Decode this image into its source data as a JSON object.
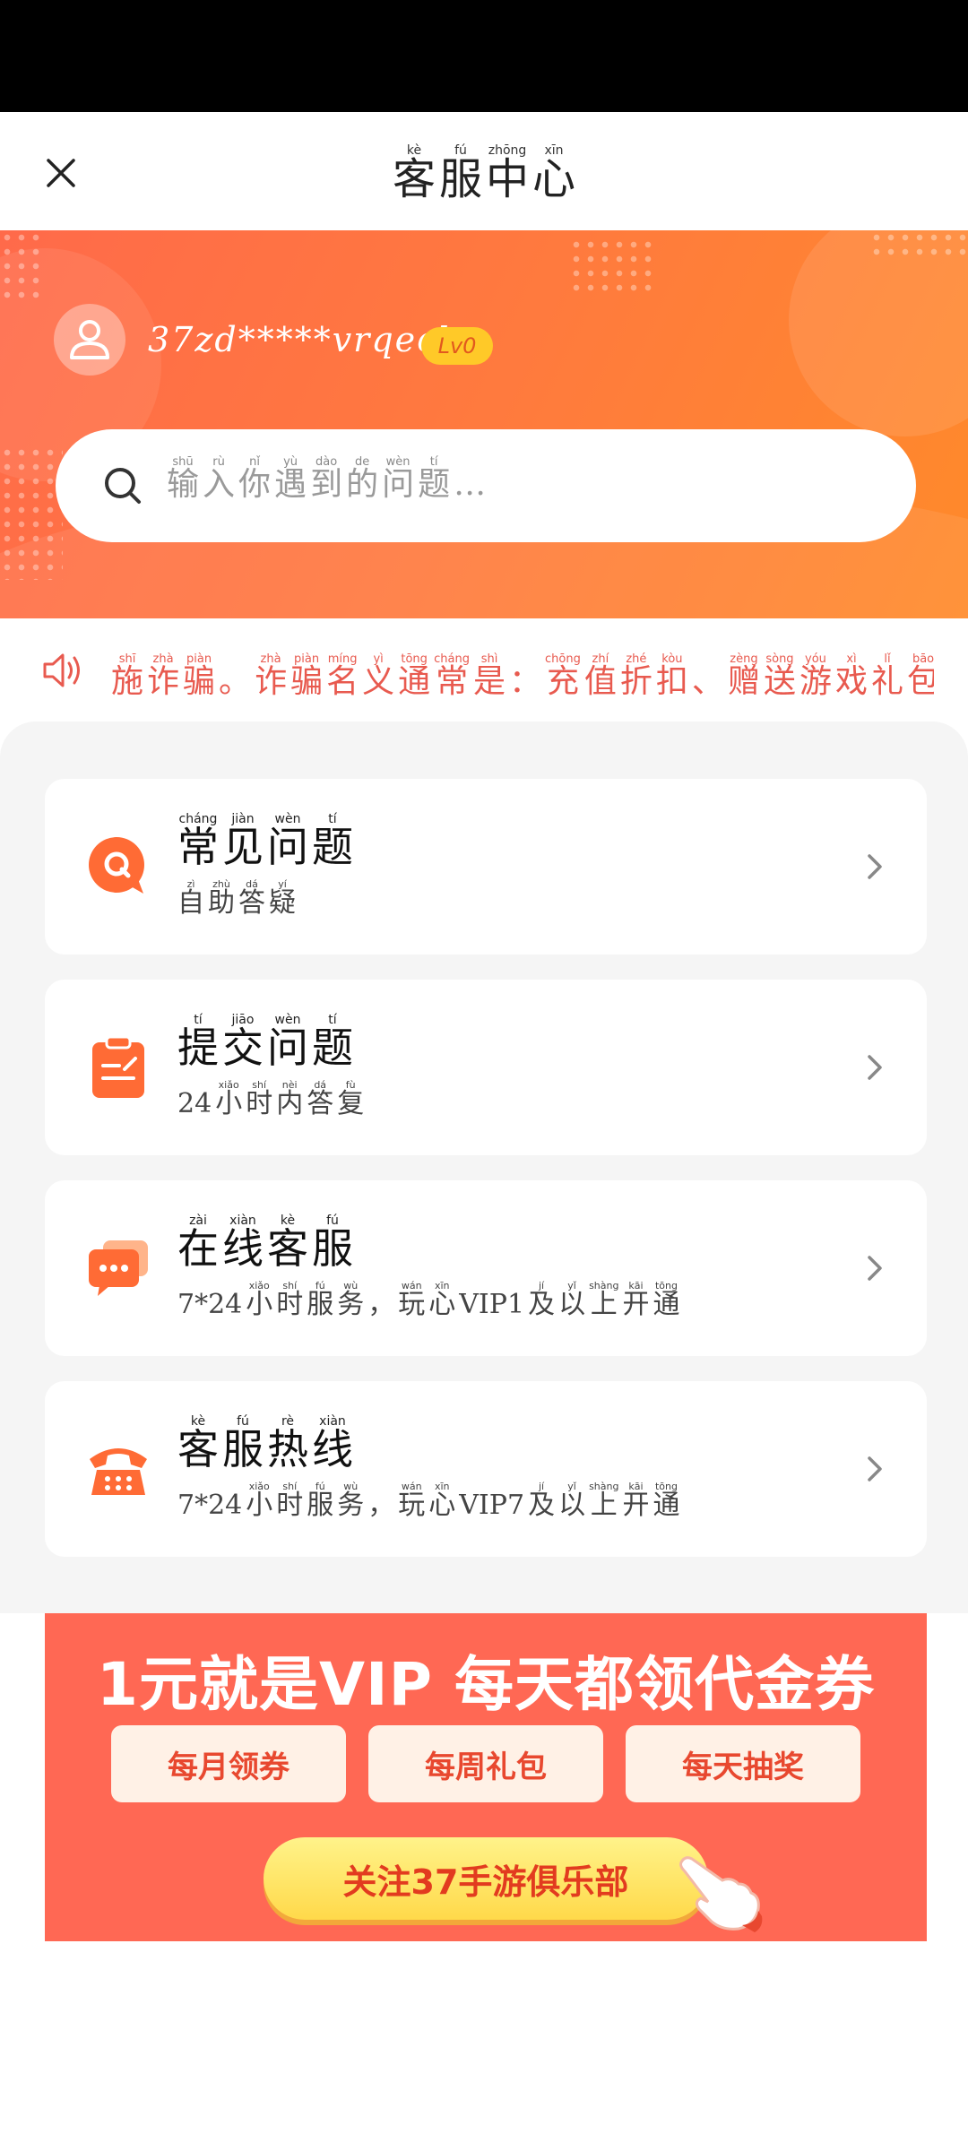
{
  "nav": {
    "title": [
      {
        "py": "kè",
        "hz": "客"
      },
      {
        "py": "fú",
        "hz": "服"
      },
      {
        "py": "zhōng",
        "hz": "中"
      },
      {
        "py": "xīn",
        "hz": "心"
      }
    ],
    "close_icon": "close-icon"
  },
  "user": {
    "username": "37zd*****vrqeck",
    "level": "Lv0"
  },
  "search": {
    "placeholder": [
      {
        "py": "shū",
        "hz": "输"
      },
      {
        "py": "rù",
        "hz": "入"
      },
      {
        "py": "nǐ",
        "hz": "你"
      },
      {
        "py": "yù",
        "hz": "遇"
      },
      {
        "py": "dào",
        "hz": "到"
      },
      {
        "py": "de",
        "hz": "的"
      },
      {
        "py": "wèn",
        "hz": "问"
      },
      {
        "py": "tí",
        "hz": "题"
      },
      {
        "py": "",
        "hz": "…"
      }
    ]
  },
  "notice": {
    "text": [
      {
        "py": "shī",
        "hz": "施"
      },
      {
        "py": "zhà",
        "hz": "诈"
      },
      {
        "py": "piàn",
        "hz": "骗"
      },
      {
        "py": "",
        "hz": "。"
      },
      {
        "py": "zhà",
        "hz": "诈"
      },
      {
        "py": "piàn",
        "hz": "骗"
      },
      {
        "py": "míng",
        "hz": "名"
      },
      {
        "py": "yì",
        "hz": "义"
      },
      {
        "py": "tōng",
        "hz": "通"
      },
      {
        "py": "cháng",
        "hz": "常"
      },
      {
        "py": "shì",
        "hz": "是"
      },
      {
        "py": "",
        "hz": "："
      },
      {
        "py": "chōng",
        "hz": "充"
      },
      {
        "py": "zhí",
        "hz": "值"
      },
      {
        "py": "zhé",
        "hz": "折"
      },
      {
        "py": "kòu",
        "hz": "扣"
      },
      {
        "py": "",
        "hz": "、"
      },
      {
        "py": "zèng",
        "hz": "赠"
      },
      {
        "py": "sòng",
        "hz": "送"
      },
      {
        "py": "yóu",
        "hz": "游"
      },
      {
        "py": "xì",
        "hz": "戏"
      },
      {
        "py": "lǐ",
        "hz": "礼"
      },
      {
        "py": "bāo",
        "hz": "包"
      }
    ]
  },
  "menu": [
    {
      "icon": "faq-q-icon",
      "title": [
        {
          "py": "cháng",
          "hz": "常"
        },
        {
          "py": "jiàn",
          "hz": "见"
        },
        {
          "py": "wèn",
          "hz": "问"
        },
        {
          "py": "tí",
          "hz": "题"
        }
      ],
      "subtitle": [
        {
          "py": "zì",
          "hz": "自"
        },
        {
          "py": "zhù",
          "hz": "助"
        },
        {
          "py": "dá",
          "hz": "答"
        },
        {
          "py": "yí",
          "hz": "疑"
        }
      ]
    },
    {
      "icon": "submit-form-icon",
      "title": [
        {
          "py": "tí",
          "hz": "提"
        },
        {
          "py": "jiāo",
          "hz": "交"
        },
        {
          "py": "wèn",
          "hz": "问"
        },
        {
          "py": "tí",
          "hz": "题"
        }
      ],
      "subtitle": [
        {
          "py": "",
          "hz": "24"
        },
        {
          "py": "xiǎo",
          "hz": "小"
        },
        {
          "py": "shí",
          "hz": "时"
        },
        {
          "py": "nèi",
          "hz": "内"
        },
        {
          "py": "dá",
          "hz": "答"
        },
        {
          "py": "fù",
          "hz": "复"
        }
      ]
    },
    {
      "icon": "chat-bubble-icon",
      "title": [
        {
          "py": "zài",
          "hz": "在"
        },
        {
          "py": "xiàn",
          "hz": "线"
        },
        {
          "py": "kè",
          "hz": "客"
        },
        {
          "py": "fú",
          "hz": "服"
        }
      ],
      "subtitle": [
        {
          "py": "",
          "hz": "7*24"
        },
        {
          "py": "xiǎo",
          "hz": "小"
        },
        {
          "py": "shí",
          "hz": "时"
        },
        {
          "py": "fú",
          "hz": "服"
        },
        {
          "py": "wù",
          "hz": "务"
        },
        {
          "py": "",
          "hz": "，"
        },
        {
          "py": "wán",
          "hz": "玩"
        },
        {
          "py": "xīn",
          "hz": "心"
        },
        {
          "py": "",
          "hz": "VIP1"
        },
        {
          "py": "jí",
          "hz": "及"
        },
        {
          "py": "yǐ",
          "hz": "以"
        },
        {
          "py": "shàng",
          "hz": "上"
        },
        {
          "py": "kāi",
          "hz": "开"
        },
        {
          "py": "tōng",
          "hz": "通"
        }
      ]
    },
    {
      "icon": "telephone-icon",
      "title": [
        {
          "py": "kè",
          "hz": "客"
        },
        {
          "py": "fú",
          "hz": "服"
        },
        {
          "py": "rè",
          "hz": "热"
        },
        {
          "py": "xiàn",
          "hz": "线"
        }
      ],
      "subtitle": [
        {
          "py": "",
          "hz": "7*24"
        },
        {
          "py": "xiǎo",
          "hz": "小"
        },
        {
          "py": "shí",
          "hz": "时"
        },
        {
          "py": "fú",
          "hz": "服"
        },
        {
          "py": "wù",
          "hz": "务"
        },
        {
          "py": "",
          "hz": "，"
        },
        {
          "py": "wán",
          "hz": "玩"
        },
        {
          "py": "xīn",
          "hz": "心"
        },
        {
          "py": "",
          "hz": "VIP7"
        },
        {
          "py": "jí",
          "hz": "及"
        },
        {
          "py": "yǐ",
          "hz": "以"
        },
        {
          "py": "shàng",
          "hz": "上"
        },
        {
          "py": "kāi",
          "hz": "开"
        },
        {
          "py": "tōng",
          "hz": "通"
        }
      ]
    }
  ],
  "banner": {
    "title": "1元就是VIP 每天都领代金券",
    "buttons": [
      "每月领券",
      "每周礼包",
      "每天抽奖"
    ],
    "follow_label": "关注37手游俱乐部"
  },
  "colors": {
    "accent": "#ff6a3d",
    "notice_text": "#e85a4f",
    "banner_bg": "#ff6854",
    "level_badge": "#ffc928"
  }
}
